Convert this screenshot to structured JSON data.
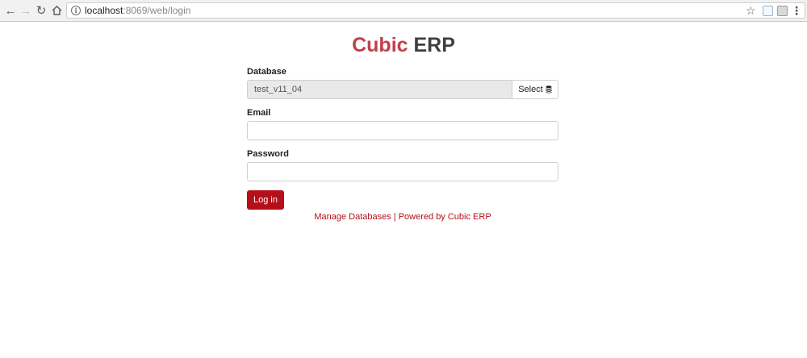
{
  "browser": {
    "url_host": "localhost",
    "url_path": ":8069/web/login",
    "icons": [
      "back-icon",
      "forward-icon",
      "reload-icon",
      "home-icon",
      "info-icon",
      "star-icon",
      "menu-icon"
    ]
  },
  "login": {
    "brand_part1": "Cubic",
    "brand_part2": "ERP",
    "database_label": "Database",
    "database_value": "test_v11_04",
    "select_label": "Select",
    "email_label": "Email",
    "email_value": "",
    "password_label": "Password",
    "password_value": "",
    "login_button": "Log in",
    "manage_databases": "Manage Databases",
    "separator": "|",
    "powered_by": "Powered by Cubic ERP"
  },
  "colors": {
    "brand_accent": "#c0404e",
    "brand_dark": "#3f3f3f",
    "button_primary": "#b50f18",
    "link": "#b50f18"
  }
}
